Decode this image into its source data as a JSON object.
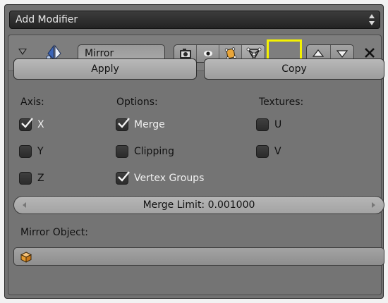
{
  "add_modifier": {
    "label": "Add Modifier"
  },
  "modifier": {
    "name": "Mirror",
    "toolbar_icons": [
      "camera-icon",
      "eye-icon",
      "edit-mode-icon",
      "cage-icon"
    ],
    "highlighted_icon": "cage-icon",
    "highlight_color": "#f5f200"
  },
  "buttons": {
    "apply": "Apply",
    "copy": "Copy"
  },
  "axis": {
    "title": "Axis:",
    "items": [
      {
        "label": "X",
        "checked": true
      },
      {
        "label": "Y",
        "checked": false
      },
      {
        "label": "Z",
        "checked": false
      }
    ]
  },
  "options": {
    "title": "Options:",
    "items": [
      {
        "label": "Merge",
        "checked": true
      },
      {
        "label": "Clipping",
        "checked": false
      },
      {
        "label": "Vertex Groups",
        "checked": true
      }
    ]
  },
  "textures": {
    "title": "Textures:",
    "items": [
      {
        "label": "U",
        "checked": false
      },
      {
        "label": "V",
        "checked": false
      }
    ]
  },
  "merge_limit": {
    "label": "Merge Limit: 0.001000"
  },
  "mirror_object": {
    "label": "Mirror Object:",
    "value": ""
  }
}
